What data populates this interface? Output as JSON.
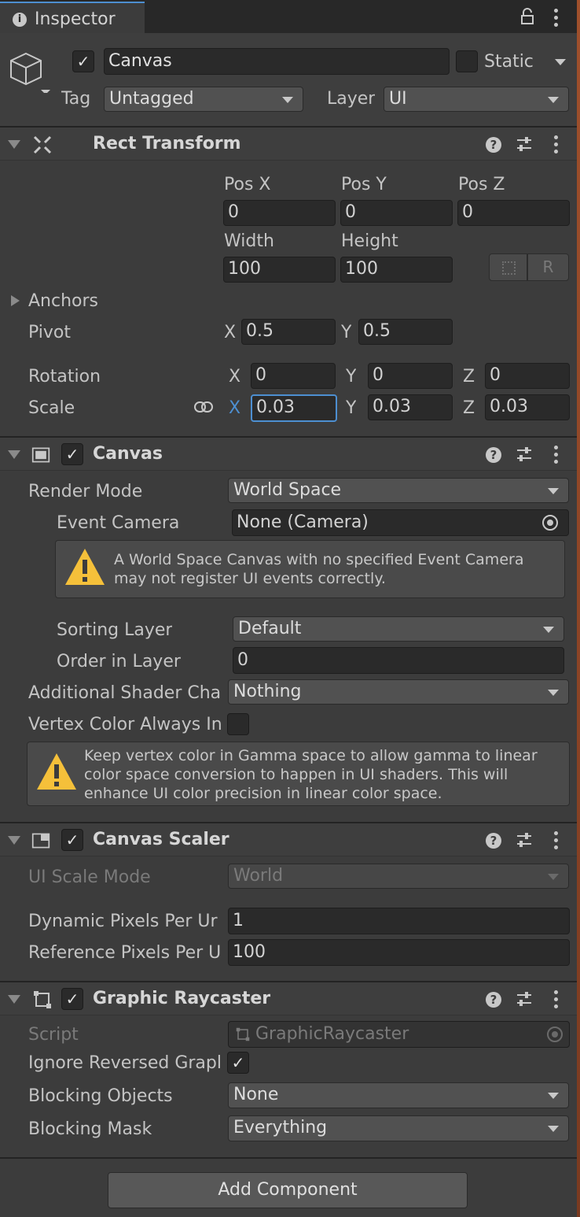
{
  "tab": {
    "title": "Inspector"
  },
  "gameobject": {
    "name": "Canvas",
    "static_label": "Static",
    "tag_label": "Tag",
    "tag_value": "Untagged",
    "layer_label": "Layer",
    "layer_value": "UI"
  },
  "rect_transform": {
    "title": "Rect Transform",
    "pos_x_label": "Pos X",
    "pos_y_label": "Pos Y",
    "pos_z_label": "Pos Z",
    "pos_x": "0",
    "pos_y": "0",
    "pos_z": "0",
    "width_label": "Width",
    "height_label": "Height",
    "width": "100",
    "height": "100",
    "raw_edit_label": "R",
    "anchors_label": "Anchors",
    "pivot_label": "Pivot",
    "pivot_x_label": "X",
    "pivot_x": "0.5",
    "pivot_y_label": "Y",
    "pivot_y": "0.5",
    "rotation_label": "Rotation",
    "rot_x_label": "X",
    "rot_x": "0",
    "rot_y_label": "Y",
    "rot_y": "0",
    "rot_z_label": "Z",
    "rot_z": "0",
    "scale_label": "Scale",
    "scale_x_label": "X",
    "scale_x": "0.03",
    "scale_y_label": "Y",
    "scale_y": "0.03",
    "scale_z_label": "Z",
    "scale_z": "0.03"
  },
  "canvas": {
    "title": "Canvas",
    "render_mode_label": "Render Mode",
    "render_mode": "World Space",
    "event_camera_label": "Event Camera",
    "event_camera": "None (Camera)",
    "warning": "A World Space Canvas with no specified Event Camera may not register UI events correctly.",
    "sorting_layer_label": "Sorting Layer",
    "sorting_layer": "Default",
    "order_label": "Order in Layer",
    "order": "0",
    "shader_label": "Additional Shader Cha",
    "shader_value": "Nothing",
    "vertex_label": "Vertex Color Always In",
    "vertex_warning": "Keep vertex color in Gamma space to allow gamma to linear color space conversion to happen in UI shaders. This will enhance UI color precision in linear color space."
  },
  "canvas_scaler": {
    "title": "Canvas Scaler",
    "scale_mode_label": "UI Scale Mode",
    "scale_mode": "World",
    "dynamic_label": "Dynamic Pixels Per Ur",
    "dynamic_value": "1",
    "reference_label": "Reference Pixels Per U",
    "reference_value": "100"
  },
  "graphic_raycaster": {
    "title": "Graphic Raycaster",
    "script_label": "Script",
    "script_value": "GraphicRaycaster",
    "ignore_label": "Ignore Reversed Grapl",
    "blocking_objects_label": "Blocking Objects",
    "blocking_objects": "None",
    "blocking_mask_label": "Blocking Mask",
    "blocking_mask": "Everything"
  },
  "add_component_label": "Add Component",
  "colors": {
    "accent": "#4d8fd1",
    "warning": "#f5c03a",
    "background": "#3c3c3c",
    "field": "#2a2a2a"
  }
}
